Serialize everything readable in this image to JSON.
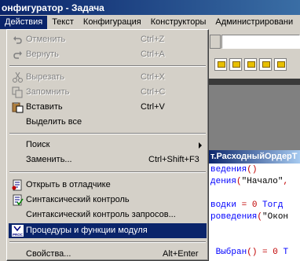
{
  "window": {
    "title": "онфигуратор - Задача"
  },
  "menubar": {
    "items": [
      {
        "label": "Действия",
        "active": true
      },
      {
        "label": "Текст"
      },
      {
        "label": "Конфигурация"
      },
      {
        "label": "Конструкторы"
      },
      {
        "label": "Администрировани"
      }
    ]
  },
  "menu": {
    "undo": {
      "label": "Отменить",
      "shortcut": "Ctrl+Z"
    },
    "redo": {
      "label": "Вернуть",
      "shortcut": "Ctrl+A"
    },
    "cut": {
      "label": "Вырезать",
      "shortcut": "Ctrl+X"
    },
    "copy": {
      "label": "Запомнить",
      "shortcut": "Ctrl+C"
    },
    "paste": {
      "label": "Вставить",
      "shortcut": "Ctrl+V"
    },
    "select_all": {
      "label": "Выделить все"
    },
    "find": {
      "label": "Поиск"
    },
    "replace": {
      "label": "Заменить...",
      "shortcut": "Ctrl+Shift+F3"
    },
    "open_debugger": {
      "label": "Открыть в отладчике"
    },
    "syntax_check": {
      "label": "Синтаксический контроль"
    },
    "query_syntax_check": {
      "label": "Синтаксический контроль запросов..."
    },
    "procedures": {
      "label": "Процедуры и функции модуля",
      "icon_text": "PROC"
    },
    "properties": {
      "label": "Свойства...",
      "shortcut": "Alt+Enter"
    }
  },
  "editor": {
    "module_title": "т.РасходныйОрдерТ",
    "code_lines": [
      [
        {
          "t": "ведения",
          "c": "blue"
        },
        {
          "t": "()",
          "c": "red"
        }
      ],
      [
        {
          "t": "дения",
          "c": "blue"
        },
        {
          "t": "(",
          "c": "red"
        },
        {
          "t": "\"Начало\"",
          "c": "blk"
        },
        {
          "t": ",",
          "c": "red"
        }
      ],
      [
        {
          "t": ""
        }
      ],
      [
        {
          "t": "водки",
          "c": "blue"
        },
        {
          "t": " = 0 ",
          "c": "red"
        },
        {
          "t": "Тогд",
          "c": "blue"
        }
      ],
      [
        {
          "t": "роведения",
          "c": "blue"
        },
        {
          "t": "(",
          "c": "red"
        },
        {
          "t": "\"Окон",
          "c": "blk"
        }
      ],
      [
        {
          "t": ""
        }
      ],
      [
        {
          "t": ""
        }
      ],
      [
        {
          "t": " Выбран",
          "c": "blue"
        },
        {
          "t": "() = 0 ",
          "c": "red"
        },
        {
          "t": "Т",
          "c": "blue"
        }
      ]
    ]
  },
  "colors": {
    "title_bar": "#0a246a",
    "selection": "#0a246a",
    "menu_bg": "#d4d0c8"
  }
}
